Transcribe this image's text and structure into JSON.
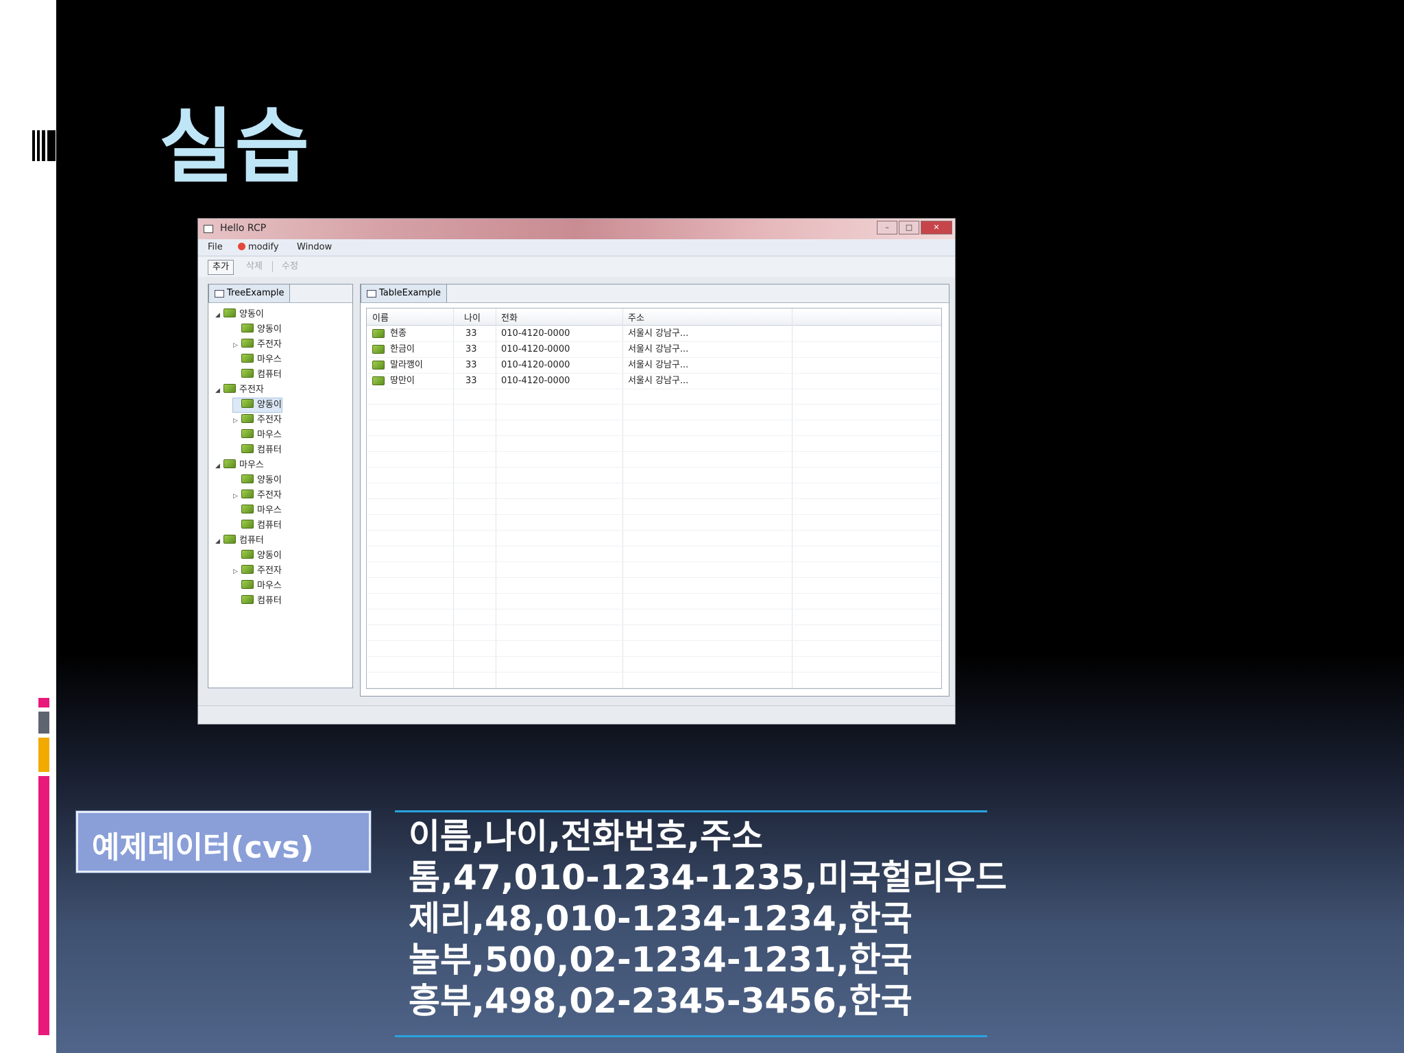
{
  "slide": {
    "title": "실습",
    "caption_label": "예제데이터(cvs)",
    "csv_lines": [
      "이름,나이,전화번호,주소",
      "톰,47,010-1234-1235,미국헐리우드",
      "제리,48,010-1234-1234,한국",
      "놀부,500,02-1234-1231,한국",
      "흥부,498,02-2345-3456,한국"
    ]
  },
  "window": {
    "title": "Hello RCP",
    "menu": [
      "File",
      "modify",
      "Window"
    ],
    "toolbar": [
      "추가",
      "삭제",
      "수정"
    ],
    "tree_view": {
      "tab": "TreeExample",
      "nodes": [
        {
          "label": "양동이",
          "children": [
            "양동이",
            "주전자",
            "마우스",
            "컴퓨터"
          ]
        },
        {
          "label": "주전자",
          "children": [
            "양동이",
            "주전자",
            "마우스",
            "컴퓨터"
          ]
        },
        {
          "label": "마우스",
          "children": [
            "양동이",
            "주전자",
            "마우스",
            "컴퓨터"
          ]
        },
        {
          "label": "컴퓨터",
          "children": [
            "양동이",
            "주전자",
            "마우스",
            "컴퓨터"
          ]
        }
      ]
    },
    "table_view": {
      "tab": "TableExample",
      "columns": [
        "이름",
        "나이",
        "전화",
        "주소"
      ],
      "rows": [
        [
          "현종",
          "33",
          "010-4120-0000",
          "서울시 강남구..."
        ],
        [
          "한금이",
          "33",
          "010-4120-0000",
          "서울시 강남구..."
        ],
        [
          "말라깽이",
          "33",
          "010-4120-0000",
          "서울시 강남구..."
        ],
        [
          "땅만이",
          "33",
          "010-4120-0000",
          "서울시 강남구..."
        ]
      ]
    },
    "controls": {
      "minimize": "–",
      "maximize": "□",
      "close": "✕"
    }
  },
  "colors": {
    "title": "#bfe6f7",
    "label_box": "#8a9fd8",
    "rule": "#29a3e0",
    "accent_pink": "#e8197b",
    "accent_gray": "#5e6470",
    "accent_orange": "#f2a900"
  }
}
